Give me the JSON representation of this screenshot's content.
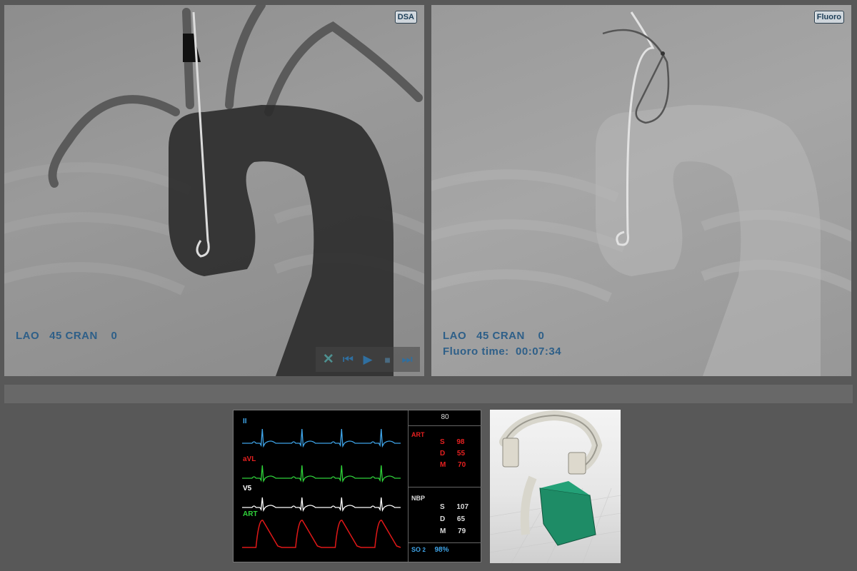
{
  "dsa_viewer": {
    "mode_badge": "DSA",
    "projection": "LAO   45 CRAN    0",
    "player_controls": {
      "close": "✕",
      "prev": "⏮",
      "play": "▶",
      "stop": "■",
      "next": "⏭"
    }
  },
  "fluoro_viewer": {
    "mode_badge": "Fluoro",
    "projection": "LAO   45 CRAN    0",
    "fluoro_time_label": "Fluoro time:",
    "fluoro_time_value": "00:07:34"
  },
  "patient_monitor": {
    "heart_rate": "80",
    "leads": {
      "ii": "II",
      "avl": "aVL",
      "v5": "V5",
      "art": "ART"
    },
    "art": {
      "label": "ART",
      "s_label": "S",
      "s_value": "98",
      "d_label": "D",
      "d_value": "55",
      "m_label": "M",
      "m_value": "70"
    },
    "nbp": {
      "label": "NBP",
      "s_label": "S",
      "s_value": "107",
      "d_label": "D",
      "d_value": "65",
      "m_label": "M",
      "m_value": "79"
    },
    "spo2": {
      "label": "SO",
      "subscript": "2",
      "value": "98%"
    }
  },
  "colors": {
    "overlay_text": "#2e5f88",
    "lead_ii": "#3fa4e8",
    "lead_avl": "#2fd13a",
    "lead_v5": "#ffffff",
    "lead_art": "#e01818",
    "vital_red": "#e62020",
    "vital_white": "#dddddd",
    "spo2_blue": "#3fa4e8"
  }
}
